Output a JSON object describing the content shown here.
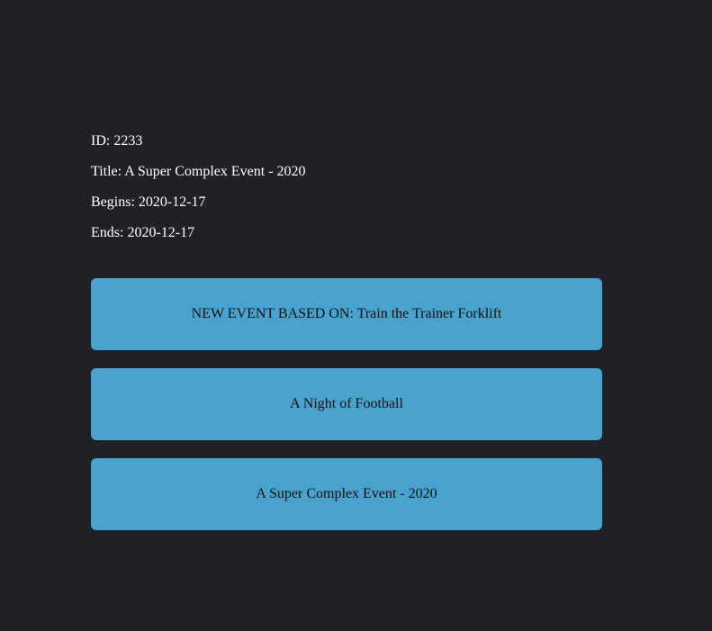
{
  "event": {
    "id_label": "ID: 2233",
    "title_label": "Title: A Super Complex Event - 2020",
    "begins_label": "Begins: 2020-12-17",
    "ends_label": "Ends: 2020-12-17"
  },
  "events": [
    {
      "label": "NEW EVENT BASED ON: Train the Trainer Forklift"
    },
    {
      "label": "A Night of Football"
    },
    {
      "label": "A Super Complex Event - 2020"
    }
  ],
  "colors": {
    "background": "#202126",
    "card": "#4aa3ce",
    "card_text": "#0d0d0d",
    "detail_text": "#ffffff"
  }
}
